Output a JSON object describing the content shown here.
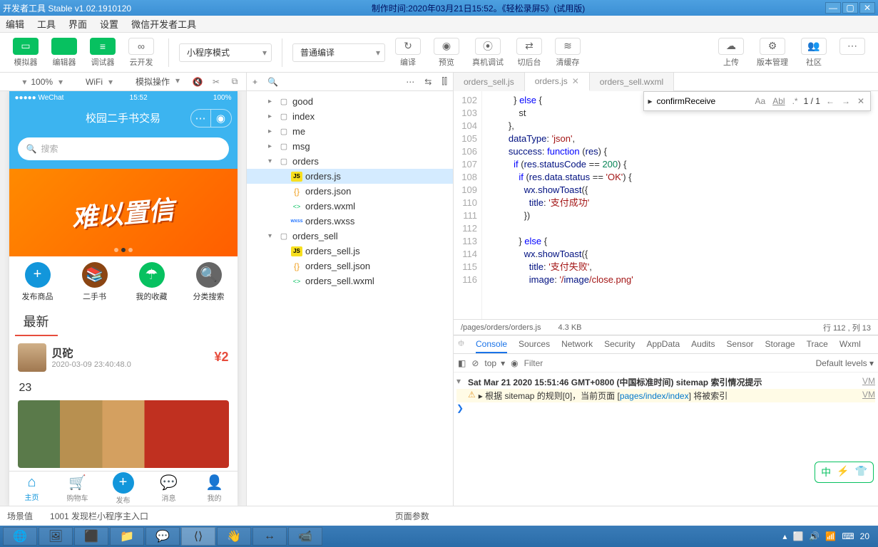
{
  "window": {
    "title_left": "开发者工具 Stable v1.02.1910120",
    "title_center": "制作时间:2020年03月21日15:52。《轻松录屏5》(试用版)"
  },
  "menubar": [
    "编辑",
    "工具",
    "界面",
    "设置",
    "微信开发者工具"
  ],
  "toolbar": {
    "left": [
      {
        "icon": "▭",
        "label": "模拟器"
      },
      {
        "icon": "</>",
        "label": "编辑器"
      },
      {
        "icon": "≡",
        "label": "调试器"
      },
      {
        "icon": "∞",
        "label": "云开发",
        "white": true
      }
    ],
    "mode": "小程序模式",
    "compile": "普通编译",
    "mid": [
      {
        "icon": "↻",
        "label": "编译"
      },
      {
        "icon": "◉",
        "label": "预览"
      },
      {
        "icon": "⦿",
        "label": "真机调试"
      },
      {
        "icon": "⇄",
        "label": "切后台"
      },
      {
        "icon": "≋",
        "label": "清缓存"
      }
    ],
    "right": [
      {
        "icon": "☁",
        "label": "上传"
      },
      {
        "icon": "⚙",
        "label": "版本管理"
      },
      {
        "icon": "👥",
        "label": "社区"
      },
      {
        "icon": "⋯",
        "label": ""
      }
    ]
  },
  "sim_opts": {
    "zoom": "100%",
    "network": "WiFi",
    "mock": "模拟操作"
  },
  "phone": {
    "status": {
      "left": "●●●●● WeChat",
      "time": "15:52",
      "right": "100%"
    },
    "nav_title": "校园二手书交易",
    "search_placeholder": "搜索",
    "banner_text": "难以置信",
    "grid": [
      {
        "label": "发布商品",
        "color": "#1296db",
        "icon": "+"
      },
      {
        "label": "二手书",
        "color": "#8b4513",
        "icon": "📚"
      },
      {
        "label": "我的收藏",
        "color": "#07c160",
        "icon": "☂"
      },
      {
        "label": "分类搜索",
        "color": "#666",
        "icon": "🔍"
      }
    ],
    "section": "最新",
    "item": {
      "name": "贝砣",
      "time": "2020-03-09 23:40:48.0",
      "price": "¥2"
    },
    "count": "23",
    "tabs": [
      {
        "label": "主页",
        "icon": "⌂",
        "active": true
      },
      {
        "label": "购物车",
        "icon": "🛒"
      },
      {
        "label": "发布",
        "icon": "+",
        "plus": true
      },
      {
        "label": "消息",
        "icon": "💬"
      },
      {
        "label": "我的",
        "icon": "👤"
      }
    ]
  },
  "tree": [
    {
      "d": 1,
      "arw": "▸",
      "type": "folder",
      "name": "good"
    },
    {
      "d": 1,
      "arw": "▸",
      "type": "folder",
      "name": "index"
    },
    {
      "d": 1,
      "arw": "▸",
      "type": "folder",
      "name": "me"
    },
    {
      "d": 1,
      "arw": "▸",
      "type": "folder",
      "name": "msg"
    },
    {
      "d": 1,
      "arw": "▾",
      "type": "folder",
      "name": "orders"
    },
    {
      "d": 2,
      "type": "js",
      "name": "orders.js",
      "sel": true
    },
    {
      "d": 2,
      "type": "json",
      "name": "orders.json"
    },
    {
      "d": 2,
      "type": "wxml",
      "name": "orders.wxml"
    },
    {
      "d": 2,
      "type": "wxss",
      "name": "orders.wxss"
    },
    {
      "d": 1,
      "arw": "▾",
      "type": "folder",
      "name": "orders_sell"
    },
    {
      "d": 2,
      "type": "js",
      "name": "orders_sell.js"
    },
    {
      "d": 2,
      "type": "json",
      "name": "orders_sell.json"
    },
    {
      "d": 2,
      "type": "wxml",
      "name": "orders_sell.wxml"
    }
  ],
  "editor": {
    "tabs": [
      {
        "name": "orders_sell.js"
      },
      {
        "name": "orders.js",
        "active": true,
        "close": true
      },
      {
        "name": "orders_sell.wxml"
      }
    ],
    "find": {
      "value": "confirmReceive",
      "count": "1 / 1"
    },
    "lines": [
      102,
      103,
      104,
      105,
      106,
      107,
      108,
      109,
      110,
      111,
      112,
      113,
      114,
      115,
      116
    ],
    "code": [
      "          } else {",
      "            st",
      "        },",
      "        dataType: 'json',",
      "        success: function (res) {",
      "          if (res.statusCode == 200) {",
      "            if (res.data.status == 'OK') {",
      "              wx.showToast({",
      "                title: '支付成功'",
      "              })",
      "",
      "            } else {",
      "              wx.showToast({",
      "                title: '支付失败',",
      "                image: '/image/close.png'"
    ],
    "status": {
      "path": "/pages/orders/orders.js",
      "size": "4.3 KB",
      "pos": "行 112 , 列 13"
    }
  },
  "devtools": {
    "tabs": [
      "Console",
      "Sources",
      "Network",
      "Security",
      "AppData",
      "Audits",
      "Sensor",
      "Storage",
      "Trace",
      "Wxml"
    ],
    "active": "Console",
    "ctx": "top",
    "filter_ph": "Filter",
    "levels": "Default levels ▾",
    "log1": "Sat Mar 21 2020 15:51:46 GMT+0800 (中国标准时间) sitemap 索引情况提示",
    "log2_a": "▸ 根据 sitemap 的规则[0]，当前页面 [",
    "log2_b": "pages/index/index",
    "log2_c": "] 将被索引",
    "vm": "VM"
  },
  "footer": {
    "scene_label": "场景值",
    "scene_val": "1001 发现栏小程序主入口",
    "params": "页面参数"
  },
  "float": [
    "中",
    "⚡",
    "👕"
  ],
  "taskbar": {
    "time": "20"
  }
}
